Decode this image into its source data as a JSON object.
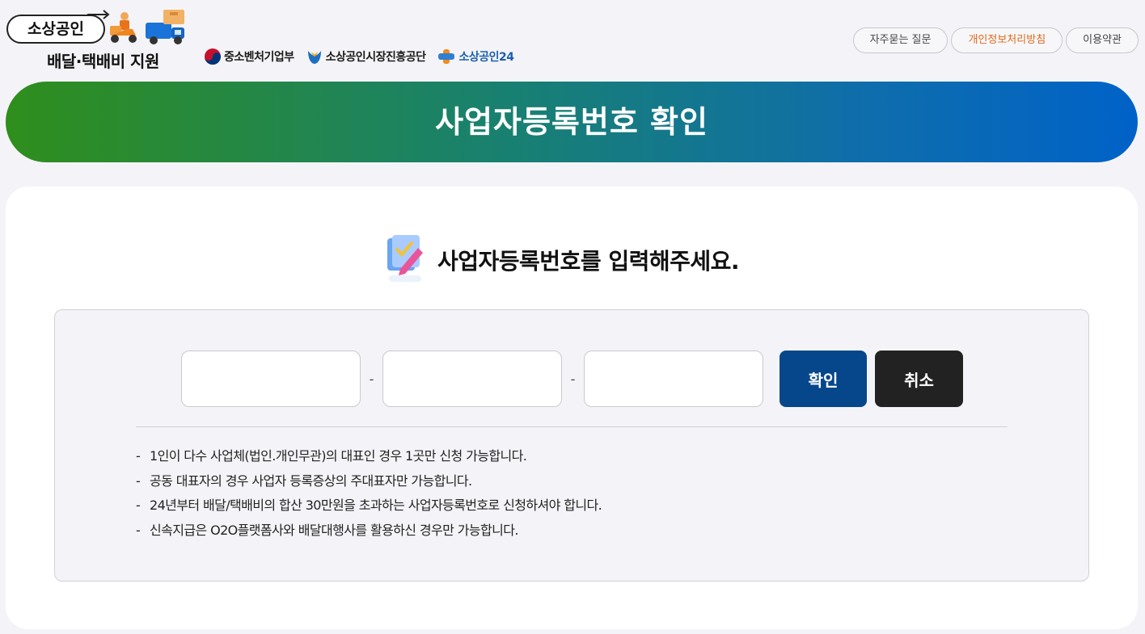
{
  "header": {
    "logo_main": "소상공인",
    "logo_sub": "배달·택배비 지원",
    "partners": [
      {
        "label": "중소벤처기업부",
        "icon": "taegeuk-icon"
      },
      {
        "label": "소상공인시장진흥공단",
        "icon": "semas-icon"
      },
      {
        "label": "소상공인24",
        "icon": "plus24-icon"
      }
    ],
    "links": {
      "faq": "자주묻는 질문",
      "privacy": "개인정보처리방침",
      "terms": "이용약관"
    }
  },
  "banner": {
    "title": "사업자등록번호 확인"
  },
  "main": {
    "heading": "사업자등록번호를 입력해주세요.",
    "heading_icon": "document-pen-icon",
    "inputs": [
      {
        "value": "",
        "placeholder": ""
      },
      {
        "value": "",
        "placeholder": ""
      },
      {
        "value": "",
        "placeholder": ""
      }
    ],
    "separator": "-",
    "confirm_label": "확인",
    "cancel_label": "취소",
    "notes": [
      "1인이 다수 사업체(법인.개인무관)의 대표인 경우 1곳만 신청 가능합니다.",
      "공동 대표자의 경우 사업자 등록증상의 주대표자만 가능합니다.",
      "24년부터 배달/택배비의 합산 30만원을 초과하는 사업자등록번호로 신청하셔야 합니다.",
      "신속지급은 O2O플랫폼사와 배달대행사를 활용하신 경우만 가능합니다."
    ],
    "note_bullet": "-"
  },
  "colors": {
    "banner_start": "#2f8e1c",
    "banner_end": "#0062c8",
    "confirm_button": "#05478a",
    "cancel_button": "#222222",
    "privacy_link": "#e06a1c"
  }
}
